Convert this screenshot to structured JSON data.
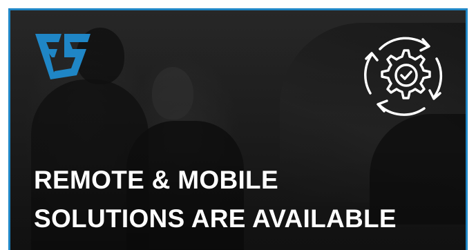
{
  "headline": {
    "line1": "REMOTE & MOBILE",
    "line2": "SOLUTIONS ARE AVAILABLE"
  },
  "icons": {
    "logo": "fs-brand-logo",
    "process": "gear-check-cycle-icon"
  },
  "colors": {
    "brand_blue": "#1f86c6",
    "headline_text": "#ffffff",
    "icon_stroke": "#ffffff"
  }
}
